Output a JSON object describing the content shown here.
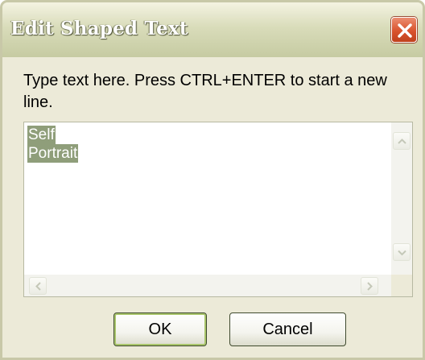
{
  "window": {
    "title": "Edit Shaped Text"
  },
  "dialog": {
    "instruction": "Type text here.  Press CTRL+ENTER to start a new line.",
    "text_lines": [
      "Self",
      "Portrait"
    ]
  },
  "buttons": {
    "ok_label": "OK",
    "cancel_label": "Cancel"
  },
  "icons": {
    "close": "close-icon",
    "scroll_up": "arrow-up-icon",
    "scroll_down": "arrow-down-icon",
    "scroll_left": "arrow-left-icon",
    "scroll_right": "arrow-right-icon"
  },
  "colors": {
    "close_button": "#d9532d",
    "selection_highlight": "#8f9e7a",
    "ok_focus_ring": "#a8c46a"
  }
}
